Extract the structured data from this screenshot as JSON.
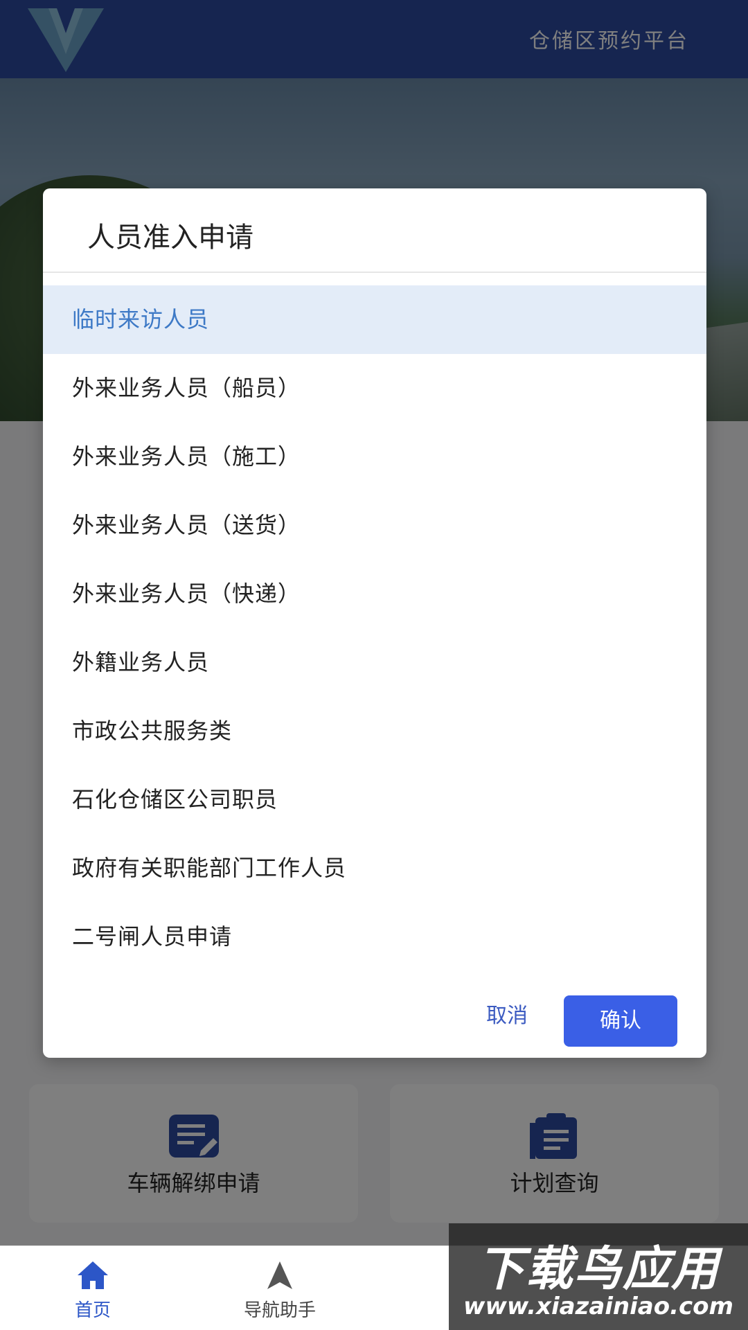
{
  "header": {
    "title": "仓储区预约平台",
    "logo_icon": "v-logo-icon"
  },
  "cards": [
    {
      "label": "车辆解绑申请",
      "icon": "edit-document-icon"
    },
    {
      "label": "计划查询",
      "icon": "clipboard-icon"
    }
  ],
  "tabbar": {
    "tabs": [
      {
        "label": "首页",
        "icon": "home-icon",
        "active": true
      },
      {
        "label": "导航助手",
        "icon": "navigation-arrow-icon",
        "active": false
      }
    ]
  },
  "dialog": {
    "title": "人员准入申请",
    "options": [
      {
        "label": "临时来访人员",
        "selected": true
      },
      {
        "label": "外来业务人员（船员）",
        "selected": false
      },
      {
        "label": "外来业务人员（施工）",
        "selected": false
      },
      {
        "label": "外来业务人员（送货）",
        "selected": false
      },
      {
        "label": "外来业务人员（快递）",
        "selected": false
      },
      {
        "label": "外籍业务人员",
        "selected": false
      },
      {
        "label": "市政公共服务类",
        "selected": false
      },
      {
        "label": "石化仓储区公司职员",
        "selected": false
      },
      {
        "label": "政府有关职能部门工作人员",
        "selected": false
      },
      {
        "label": "二号闸人员申请",
        "selected": false
      }
    ],
    "cancel_label": "取消",
    "confirm_label": "确认"
  },
  "watermark": {
    "main": "下载鸟应用",
    "url": "www.xiazainiao.com"
  },
  "colors": {
    "header_bg": "#2c4aa0",
    "accent_blue": "#3a5fe6",
    "selected_bg": "#e3ecf8",
    "selected_text": "#3d79c6"
  }
}
